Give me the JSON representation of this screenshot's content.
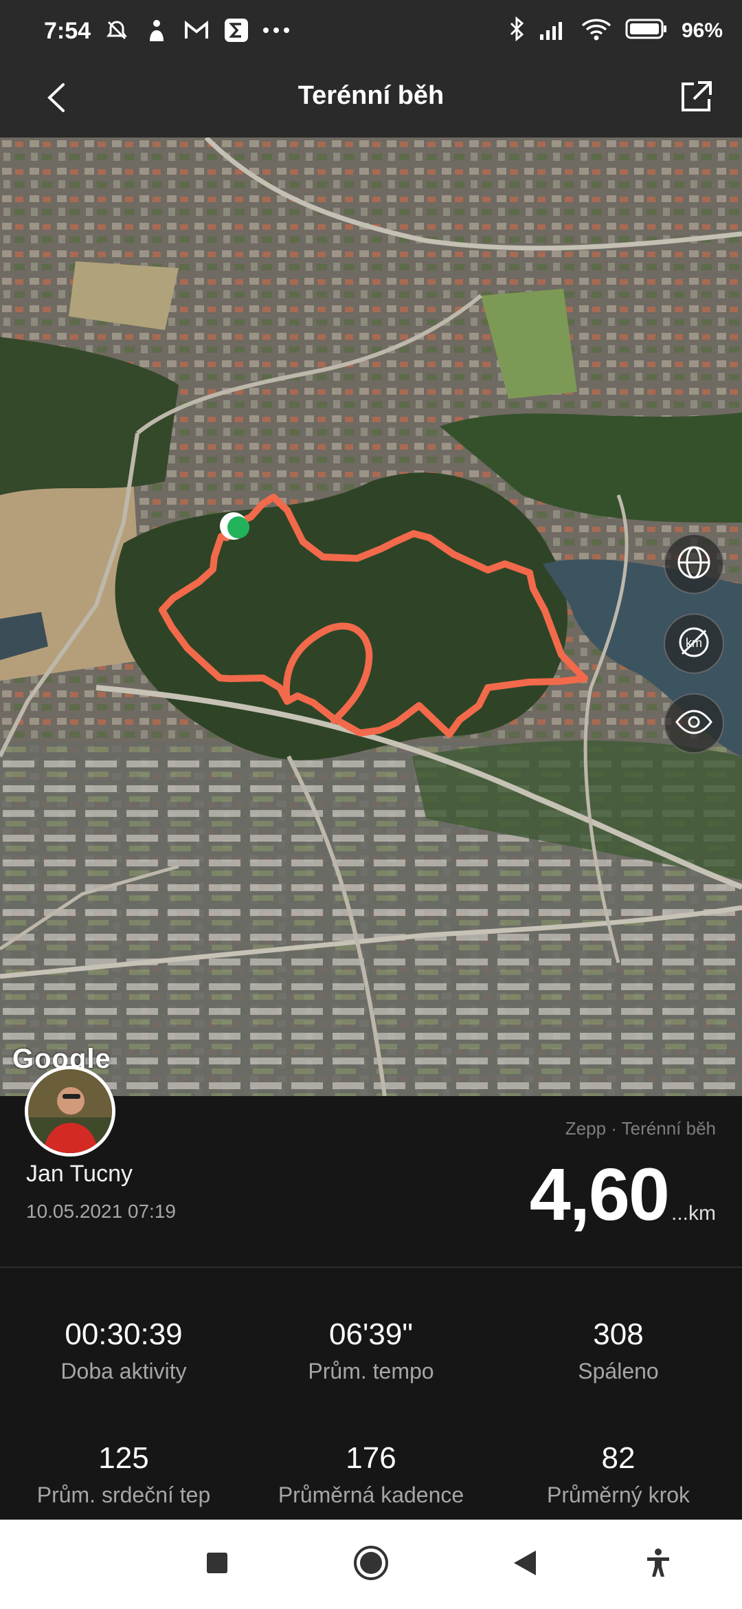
{
  "status_bar": {
    "time": "7:54",
    "battery_percent": "96%",
    "left_icons": [
      "alarm-off-icon",
      "shazam-icon",
      "gmail-icon",
      "sigma-icon",
      "more-dots-icon"
    ],
    "right_icons": [
      "bluetooth-icon",
      "signal-icon",
      "wifi-icon",
      "battery-icon"
    ]
  },
  "app_bar": {
    "title": "Terénní běh",
    "back_icon": "chevron-left-icon",
    "share_icon": "share-external-icon"
  },
  "map": {
    "attribution": "Google",
    "route_color": "#f26a4b",
    "start_marker_color": "#22b35a",
    "controls": [
      "globe-icon",
      "km-toggle-icon",
      "eye-icon"
    ]
  },
  "summary": {
    "source": "Zepp · Terénní běh",
    "user_name": "Jan Tucny",
    "date": "10.05.2021 07:19",
    "distance_value": "4,60",
    "distance_unit": "...km"
  },
  "stats": [
    {
      "value": "00:30:39",
      "label": "Doba aktivity"
    },
    {
      "value": "06'39\"",
      "label": "Prům. tempo"
    },
    {
      "value": "308",
      "label": "Spáleno"
    },
    {
      "value": "125",
      "label": "Prům. srdeční tep"
    },
    {
      "value": "176",
      "label": "Průměrná kadence"
    },
    {
      "value": "82",
      "label": "Průměrný krok"
    }
  ],
  "nav_bar": [
    "recents-square-icon",
    "home-circle-icon",
    "back-triangle-icon",
    "accessibility-icon"
  ]
}
